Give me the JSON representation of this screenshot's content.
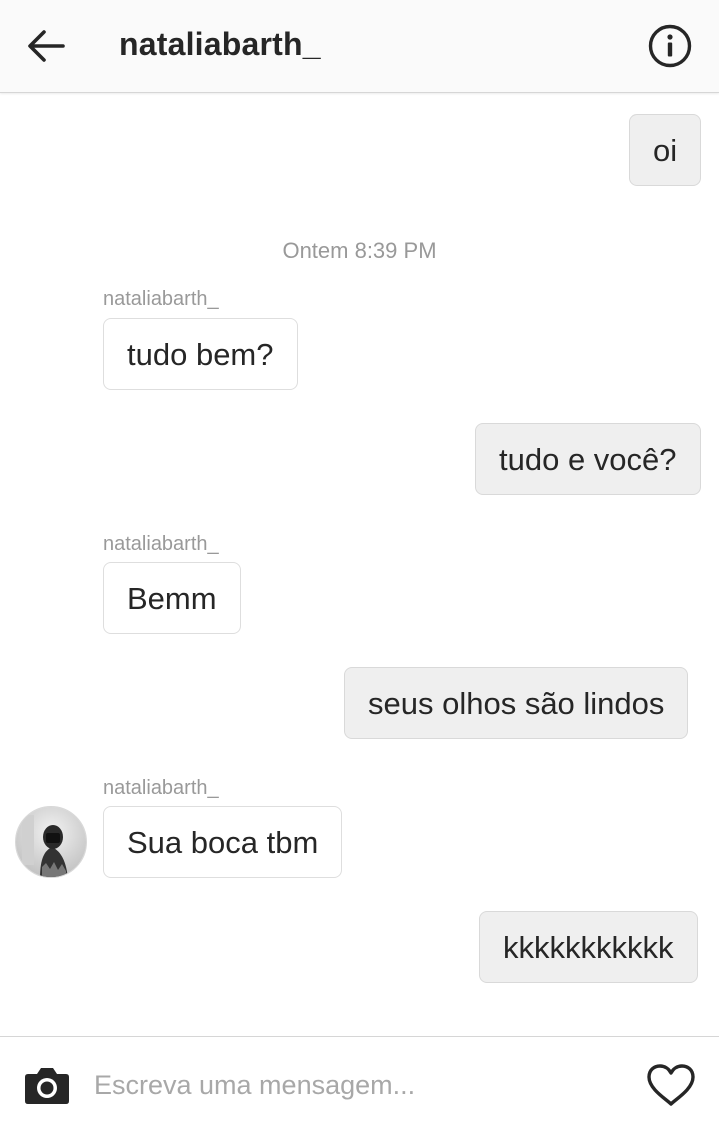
{
  "header": {
    "title": "nataliabarth_",
    "back_icon": "arrow-left-icon",
    "info_icon": "info-circle-icon"
  },
  "thread": {
    "timestamp": "Ontem 8:39 PM",
    "messages": [
      {
        "direction": "out",
        "text": "oi"
      },
      {
        "direction": "in",
        "sender": "nataliabarth_",
        "text": "tudo bem?"
      },
      {
        "direction": "out",
        "text": "tudo e você?"
      },
      {
        "direction": "in",
        "sender": "nataliabarth_",
        "text": "Bemm"
      },
      {
        "direction": "out",
        "text": "seus olhos são lindos"
      },
      {
        "direction": "in",
        "sender": "nataliabarth_",
        "text": "Sua boca tbm",
        "has_avatar": true
      },
      {
        "direction": "out",
        "text": "kkkkkkkkkkk"
      }
    ]
  },
  "composer": {
    "placeholder": "Escreva uma mensagem...",
    "value": "",
    "camera_icon": "camera-icon",
    "heart_icon": "heart-icon"
  },
  "colors": {
    "outgoing_bubble": "#efefef",
    "incoming_bubble": "#ffffff",
    "meta_text": "#999999",
    "primary_text": "#262626"
  }
}
